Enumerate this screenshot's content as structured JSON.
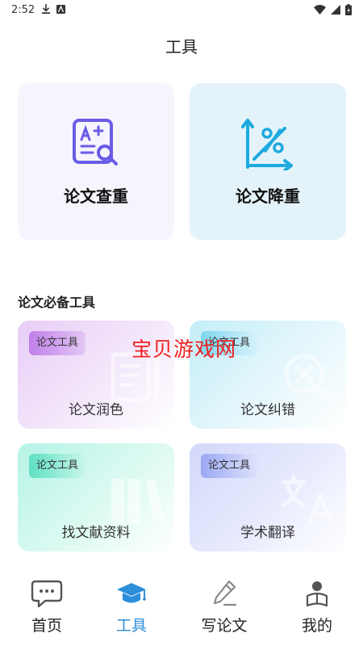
{
  "status_bar": {
    "time": "2:52"
  },
  "header": {
    "title": "工具"
  },
  "top_tools": [
    {
      "label": "论文查重"
    },
    {
      "label": "论文降重"
    }
  ],
  "section": {
    "title": "论文必备工具"
  },
  "tools": [
    {
      "tag": "论文工具",
      "label": "论文润色"
    },
    {
      "tag": "论文工具",
      "label": "论文纠错"
    },
    {
      "tag": "论文工具",
      "label": "找文献资料"
    },
    {
      "tag": "论文工具",
      "label": "学术翻译"
    }
  ],
  "watermark": "宝贝游戏网",
  "nav": {
    "items": [
      {
        "label": "首页",
        "icon": "chat-bubble-icon"
      },
      {
        "label": "工具",
        "icon": "graduation-cap-icon"
      },
      {
        "label": "写论文",
        "icon": "pencil-icon"
      },
      {
        "label": "我的",
        "icon": "user-reading-icon"
      }
    ],
    "active_index": 1,
    "active_color": "#2d8fd9"
  }
}
